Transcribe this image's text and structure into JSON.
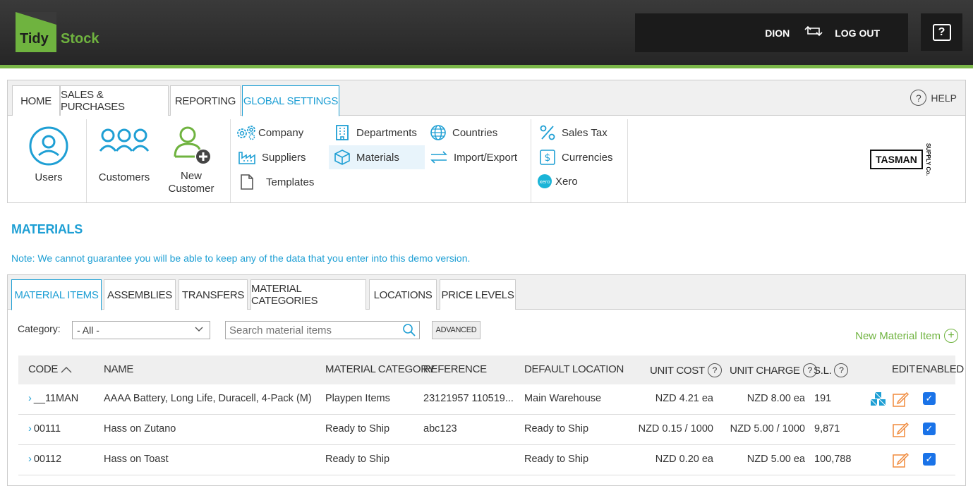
{
  "brand": {
    "part1": "Tidy",
    "part2": "Stock"
  },
  "user": {
    "name": "DION",
    "logout": "LOG OUT"
  },
  "nav": {
    "tabs": [
      "HOME",
      "SALES & PURCHASES",
      "REPORTING",
      "GLOBAL SETTINGS"
    ],
    "active_tab": "GLOBAL SETTINGS",
    "help": "HELP",
    "big_items": [
      {
        "label": "Users"
      },
      {
        "label": "Customers"
      },
      {
        "label": "New",
        "label2": "Customer"
      }
    ],
    "menu": {
      "company": "Company",
      "suppliers": "Suppliers",
      "templates": "Templates",
      "departments": "Departments",
      "materials": "Materials",
      "countries": "Countries",
      "import_export": "Import/Export",
      "sales_tax": "Sales Tax",
      "currencies": "Currencies",
      "xero": "Xero"
    },
    "org_logo": {
      "name": "TASMAN",
      "sub": "SUPPLY Co."
    }
  },
  "page": {
    "title": "MATERIALS",
    "note": "Note: We cannot guarantee you will be able to keep any of the data that you enter into this demo version."
  },
  "subtabs": [
    "MATERIAL ITEMS",
    "ASSEMBLIES",
    "TRANSFERS",
    "MATERIAL CATEGORIES",
    "LOCATIONS",
    "PRICE LEVELS"
  ],
  "filters": {
    "category_label": "Category:",
    "category_value": "- All -",
    "search_placeholder": "Search material items",
    "advanced": "ADVANCED",
    "new_item": "New Material Item"
  },
  "table": {
    "headers": {
      "code": "CODE",
      "name": "NAME",
      "category": "MATERIAL CATEGORY",
      "reference": "REFERENCE",
      "location": "DEFAULT LOCATION",
      "unit_cost": "UNIT COST",
      "unit_charge": "UNIT CHARGE",
      "sl": "S.L.",
      "edit": "EDIT",
      "enabled": "ENABLED"
    },
    "rows": [
      {
        "code": "__11MAN",
        "name": "AAAA Battery, Long Life, Duracell, 4-Pack (M)",
        "category": "Playpen Items",
        "reference": "23121957 110519...",
        "location": "Main Warehouse",
        "unit_cost": "NZD 4.21 ea",
        "unit_charge": "NZD 8.00 ea",
        "sl": "191",
        "assembly": true,
        "enabled": true
      },
      {
        "code": "00111",
        "name": "Hass on Zutano",
        "category": "Ready to Ship",
        "reference": "abc123",
        "location": "Ready to Ship",
        "unit_cost": "NZD 0.15 / 1000",
        "unit_charge": "NZD 5.00 / 1000",
        "sl": "9,871",
        "assembly": false,
        "enabled": true
      },
      {
        "code": "00112",
        "name": "Hass on Toast",
        "category": "Ready to Ship",
        "reference": "",
        "location": "Ready to Ship",
        "unit_cost": "NZD 0.20 ea",
        "unit_charge": "NZD 5.00 ea",
        "sl": "100,788",
        "assembly": false,
        "enabled": true
      }
    ]
  }
}
